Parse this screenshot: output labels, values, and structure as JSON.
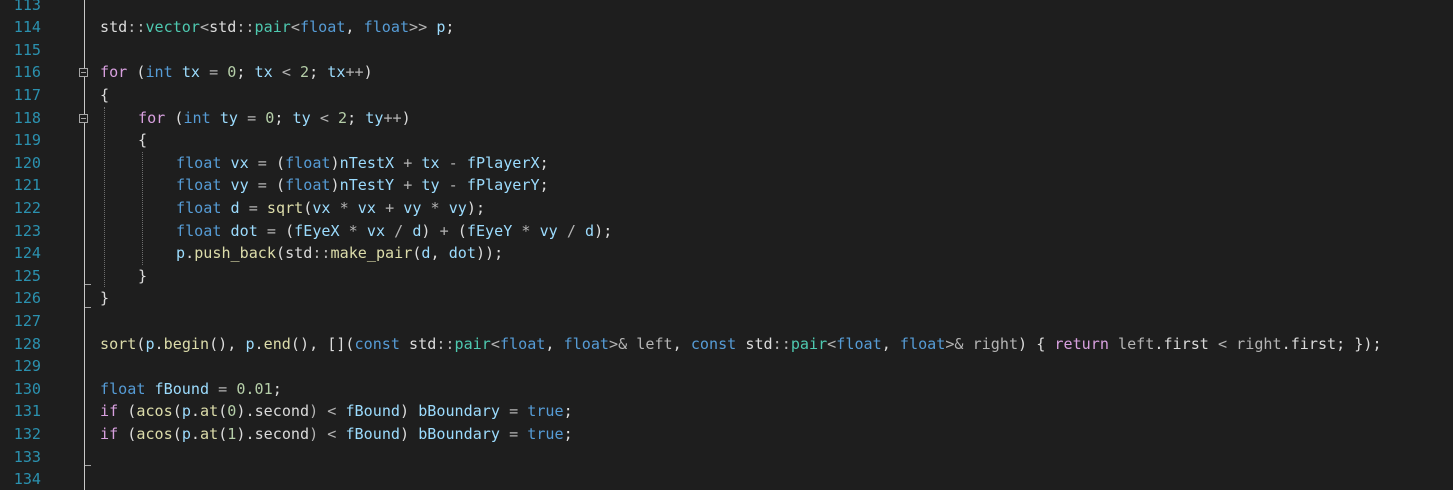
{
  "editor": {
    "lines": [
      {
        "num": "113",
        "tokens": []
      },
      {
        "num": "114",
        "indent": 0,
        "tokens": [
          {
            "t": "std",
            "c": "pl"
          },
          {
            "t": "::",
            "c": "gray"
          },
          {
            "t": "vector",
            "c": "typ"
          },
          {
            "t": "<",
            "c": "gray"
          },
          {
            "t": "std",
            "c": "pl"
          },
          {
            "t": "::",
            "c": "gray"
          },
          {
            "t": "pair",
            "c": "typ"
          },
          {
            "t": "<",
            "c": "gray"
          },
          {
            "t": "float",
            "c": "kw"
          },
          {
            "t": ", ",
            "c": "pl"
          },
          {
            "t": "float",
            "c": "kw"
          },
          {
            "t": ">> ",
            "c": "gray"
          },
          {
            "t": "p",
            "c": "var"
          },
          {
            "t": ";",
            "c": "pl"
          }
        ]
      },
      {
        "num": "115",
        "tokens": []
      },
      {
        "num": "116",
        "indent": 0,
        "fold": true,
        "tokens": [
          {
            "t": "for",
            "c": "ctl"
          },
          {
            "t": " (",
            "c": "pl"
          },
          {
            "t": "int",
            "c": "kw"
          },
          {
            "t": " ",
            "c": "pl"
          },
          {
            "t": "tx",
            "c": "var"
          },
          {
            "t": " = ",
            "c": "gray"
          },
          {
            "t": "0",
            "c": "num"
          },
          {
            "t": "; ",
            "c": "pl"
          },
          {
            "t": "tx",
            "c": "var"
          },
          {
            "t": " < ",
            "c": "gray"
          },
          {
            "t": "2",
            "c": "num"
          },
          {
            "t": "; ",
            "c": "pl"
          },
          {
            "t": "tx",
            "c": "var"
          },
          {
            "t": "++",
            "c": "gray"
          },
          {
            "t": ")",
            "c": "pl"
          }
        ]
      },
      {
        "num": "117",
        "indent": 0,
        "tokens": [
          {
            "t": "{",
            "c": "pl"
          }
        ]
      },
      {
        "num": "118",
        "indent": 1,
        "fold": true,
        "tokens": [
          {
            "t": "for",
            "c": "ctl"
          },
          {
            "t": " (",
            "c": "pl"
          },
          {
            "t": "int",
            "c": "kw"
          },
          {
            "t": " ",
            "c": "pl"
          },
          {
            "t": "ty",
            "c": "var"
          },
          {
            "t": " = ",
            "c": "gray"
          },
          {
            "t": "0",
            "c": "num"
          },
          {
            "t": "; ",
            "c": "pl"
          },
          {
            "t": "ty",
            "c": "var"
          },
          {
            "t": " < ",
            "c": "gray"
          },
          {
            "t": "2",
            "c": "num"
          },
          {
            "t": "; ",
            "c": "pl"
          },
          {
            "t": "ty",
            "c": "var"
          },
          {
            "t": "++",
            "c": "gray"
          },
          {
            "t": ")",
            "c": "pl"
          }
        ]
      },
      {
        "num": "119",
        "indent": 1,
        "tokens": [
          {
            "t": "{",
            "c": "pl"
          }
        ]
      },
      {
        "num": "120",
        "indent": 2,
        "tokens": [
          {
            "t": "float",
            "c": "kw"
          },
          {
            "t": " ",
            "c": "pl"
          },
          {
            "t": "vx",
            "c": "var"
          },
          {
            "t": " = ",
            "c": "gray"
          },
          {
            "t": "(",
            "c": "pl"
          },
          {
            "t": "float",
            "c": "kw"
          },
          {
            "t": ")",
            "c": "pl"
          },
          {
            "t": "nTestX",
            "c": "var"
          },
          {
            "t": " + ",
            "c": "gray"
          },
          {
            "t": "tx",
            "c": "var"
          },
          {
            "t": " - ",
            "c": "gray"
          },
          {
            "t": "fPlayerX",
            "c": "var"
          },
          {
            "t": ";",
            "c": "pl"
          }
        ]
      },
      {
        "num": "121",
        "indent": 2,
        "tokens": [
          {
            "t": "float",
            "c": "kw"
          },
          {
            "t": " ",
            "c": "pl"
          },
          {
            "t": "vy",
            "c": "var"
          },
          {
            "t": " = ",
            "c": "gray"
          },
          {
            "t": "(",
            "c": "pl"
          },
          {
            "t": "float",
            "c": "kw"
          },
          {
            "t": ")",
            "c": "pl"
          },
          {
            "t": "nTestY",
            "c": "var"
          },
          {
            "t": " + ",
            "c": "gray"
          },
          {
            "t": "ty",
            "c": "var"
          },
          {
            "t": " - ",
            "c": "gray"
          },
          {
            "t": "fPlayerY",
            "c": "var"
          },
          {
            "t": ";",
            "c": "pl"
          }
        ]
      },
      {
        "num": "122",
        "indent": 2,
        "tokens": [
          {
            "t": "float",
            "c": "kw"
          },
          {
            "t": " ",
            "c": "pl"
          },
          {
            "t": "d",
            "c": "var"
          },
          {
            "t": " = ",
            "c": "gray"
          },
          {
            "t": "sqrt",
            "c": "fn"
          },
          {
            "t": "(",
            "c": "pl"
          },
          {
            "t": "vx",
            "c": "var"
          },
          {
            "t": " * ",
            "c": "gray"
          },
          {
            "t": "vx",
            "c": "var"
          },
          {
            "t": " + ",
            "c": "gray"
          },
          {
            "t": "vy",
            "c": "var"
          },
          {
            "t": " * ",
            "c": "gray"
          },
          {
            "t": "vy",
            "c": "var"
          },
          {
            "t": ");",
            "c": "pl"
          }
        ]
      },
      {
        "num": "123",
        "indent": 2,
        "tokens": [
          {
            "t": "float",
            "c": "kw"
          },
          {
            "t": " ",
            "c": "pl"
          },
          {
            "t": "dot",
            "c": "var"
          },
          {
            "t": " = ",
            "c": "gray"
          },
          {
            "t": "(",
            "c": "pl"
          },
          {
            "t": "fEyeX",
            "c": "var"
          },
          {
            "t": " * ",
            "c": "gray"
          },
          {
            "t": "vx",
            "c": "var"
          },
          {
            "t": " / ",
            "c": "gray"
          },
          {
            "t": "d",
            "c": "var"
          },
          {
            "t": ") ",
            "c": "pl"
          },
          {
            "t": "+",
            "c": "gray"
          },
          {
            "t": " (",
            "c": "pl"
          },
          {
            "t": "fEyeY",
            "c": "var"
          },
          {
            "t": " * ",
            "c": "gray"
          },
          {
            "t": "vy",
            "c": "var"
          },
          {
            "t": " / ",
            "c": "gray"
          },
          {
            "t": "d",
            "c": "var"
          },
          {
            "t": ");",
            "c": "pl"
          }
        ]
      },
      {
        "num": "124",
        "indent": 2,
        "tokens": [
          {
            "t": "p",
            "c": "var"
          },
          {
            "t": ".",
            "c": "pl"
          },
          {
            "t": "push_back",
            "c": "fn"
          },
          {
            "t": "(",
            "c": "pl"
          },
          {
            "t": "std",
            "c": "pl"
          },
          {
            "t": "::",
            "c": "gray"
          },
          {
            "t": "make_pair",
            "c": "fn"
          },
          {
            "t": "(",
            "c": "pl"
          },
          {
            "t": "d",
            "c": "var"
          },
          {
            "t": ", ",
            "c": "pl"
          },
          {
            "t": "dot",
            "c": "var"
          },
          {
            "t": "));",
            "c": "pl"
          }
        ]
      },
      {
        "num": "125",
        "indent": 1,
        "tokens": [
          {
            "t": "}",
            "c": "pl"
          }
        ]
      },
      {
        "num": "126",
        "indent": 0,
        "tokens": [
          {
            "t": "}",
            "c": "pl"
          }
        ]
      },
      {
        "num": "127",
        "tokens": []
      },
      {
        "num": "128",
        "indent": 0,
        "tokens": [
          {
            "t": "sort",
            "c": "fn"
          },
          {
            "t": "(",
            "c": "pl"
          },
          {
            "t": "p",
            "c": "var"
          },
          {
            "t": ".",
            "c": "pl"
          },
          {
            "t": "begin",
            "c": "fn"
          },
          {
            "t": "(), ",
            "c": "pl"
          },
          {
            "t": "p",
            "c": "var"
          },
          {
            "t": ".",
            "c": "pl"
          },
          {
            "t": "end",
            "c": "fn"
          },
          {
            "t": "(), [](",
            "c": "pl"
          },
          {
            "t": "const",
            "c": "kw"
          },
          {
            "t": " std",
            "c": "pl"
          },
          {
            "t": "::",
            "c": "gray"
          },
          {
            "t": "pair",
            "c": "typ"
          },
          {
            "t": "<",
            "c": "gray"
          },
          {
            "t": "float",
            "c": "kw"
          },
          {
            "t": ", ",
            "c": "pl"
          },
          {
            "t": "float",
            "c": "kw"
          },
          {
            "t": ">& ",
            "c": "gray"
          },
          {
            "t": "left",
            "c": "gray"
          },
          {
            "t": ", ",
            "c": "pl"
          },
          {
            "t": "const",
            "c": "kw"
          },
          {
            "t": " std",
            "c": "pl"
          },
          {
            "t": "::",
            "c": "gray"
          },
          {
            "t": "pair",
            "c": "typ"
          },
          {
            "t": "<",
            "c": "gray"
          },
          {
            "t": "float",
            "c": "kw"
          },
          {
            "t": ", ",
            "c": "pl"
          },
          {
            "t": "float",
            "c": "kw"
          },
          {
            "t": ">& ",
            "c": "gray"
          },
          {
            "t": "right",
            "c": "gray"
          },
          {
            "t": ") { ",
            "c": "pl"
          },
          {
            "t": "return",
            "c": "ctl"
          },
          {
            "t": " left",
            "c": "gray"
          },
          {
            "t": ".",
            "c": "pl"
          },
          {
            "t": "first",
            "c": "mem"
          },
          {
            "t": " < ",
            "c": "gray"
          },
          {
            "t": "right",
            "c": "gray"
          },
          {
            "t": ".",
            "c": "pl"
          },
          {
            "t": "first",
            "c": "mem"
          },
          {
            "t": "; });",
            "c": "pl"
          }
        ]
      },
      {
        "num": "129",
        "tokens": []
      },
      {
        "num": "130",
        "indent": 0,
        "tokens": [
          {
            "t": "float",
            "c": "kw"
          },
          {
            "t": " ",
            "c": "pl"
          },
          {
            "t": "fBound",
            "c": "var"
          },
          {
            "t": " = ",
            "c": "gray"
          },
          {
            "t": "0.01",
            "c": "num"
          },
          {
            "t": ";",
            "c": "pl"
          }
        ]
      },
      {
        "num": "131",
        "indent": 0,
        "tokens": [
          {
            "t": "if",
            "c": "ctl"
          },
          {
            "t": " (",
            "c": "pl"
          },
          {
            "t": "acos",
            "c": "fn"
          },
          {
            "t": "(",
            "c": "pl"
          },
          {
            "t": "p",
            "c": "var"
          },
          {
            "t": ".",
            "c": "pl"
          },
          {
            "t": "at",
            "c": "fn"
          },
          {
            "t": "(",
            "c": "pl"
          },
          {
            "t": "0",
            "c": "num"
          },
          {
            "t": ").",
            "c": "pl"
          },
          {
            "t": "second",
            "c": "mem"
          },
          {
            "t": ") < ",
            "c": "gray"
          },
          {
            "t": "fBound",
            "c": "var"
          },
          {
            "t": ") ",
            "c": "pl"
          },
          {
            "t": "bBoundary",
            "c": "var"
          },
          {
            "t": " = ",
            "c": "gray"
          },
          {
            "t": "true",
            "c": "kw"
          },
          {
            "t": ";",
            "c": "pl"
          }
        ]
      },
      {
        "num": "132",
        "indent": 0,
        "tokens": [
          {
            "t": "if",
            "c": "ctl"
          },
          {
            "t": " (",
            "c": "pl"
          },
          {
            "t": "acos",
            "c": "fn"
          },
          {
            "t": "(",
            "c": "pl"
          },
          {
            "t": "p",
            "c": "var"
          },
          {
            "t": ".",
            "c": "pl"
          },
          {
            "t": "at",
            "c": "fn"
          },
          {
            "t": "(",
            "c": "pl"
          },
          {
            "t": "1",
            "c": "num"
          },
          {
            "t": ").",
            "c": "pl"
          },
          {
            "t": "second",
            "c": "mem"
          },
          {
            "t": ") < ",
            "c": "gray"
          },
          {
            "t": "fBound",
            "c": "var"
          },
          {
            "t": ") ",
            "c": "pl"
          },
          {
            "t": "bBoundary",
            "c": "var"
          },
          {
            "t": " = ",
            "c": "gray"
          },
          {
            "t": "true",
            "c": "kw"
          },
          {
            "t": ";",
            "c": "pl"
          }
        ]
      },
      {
        "num": "133",
        "tokens": []
      },
      {
        "num": "134",
        "tokens": []
      }
    ],
    "colors": {
      "background": "#1e1e1e",
      "line_number": "#2b91af",
      "keyword": "#569cd6",
      "control_keyword": "#d8a0df",
      "type": "#4ec9b0",
      "function": "#dcdcaa",
      "variable": "#9cdcfe",
      "number": "#b5cea8"
    }
  }
}
